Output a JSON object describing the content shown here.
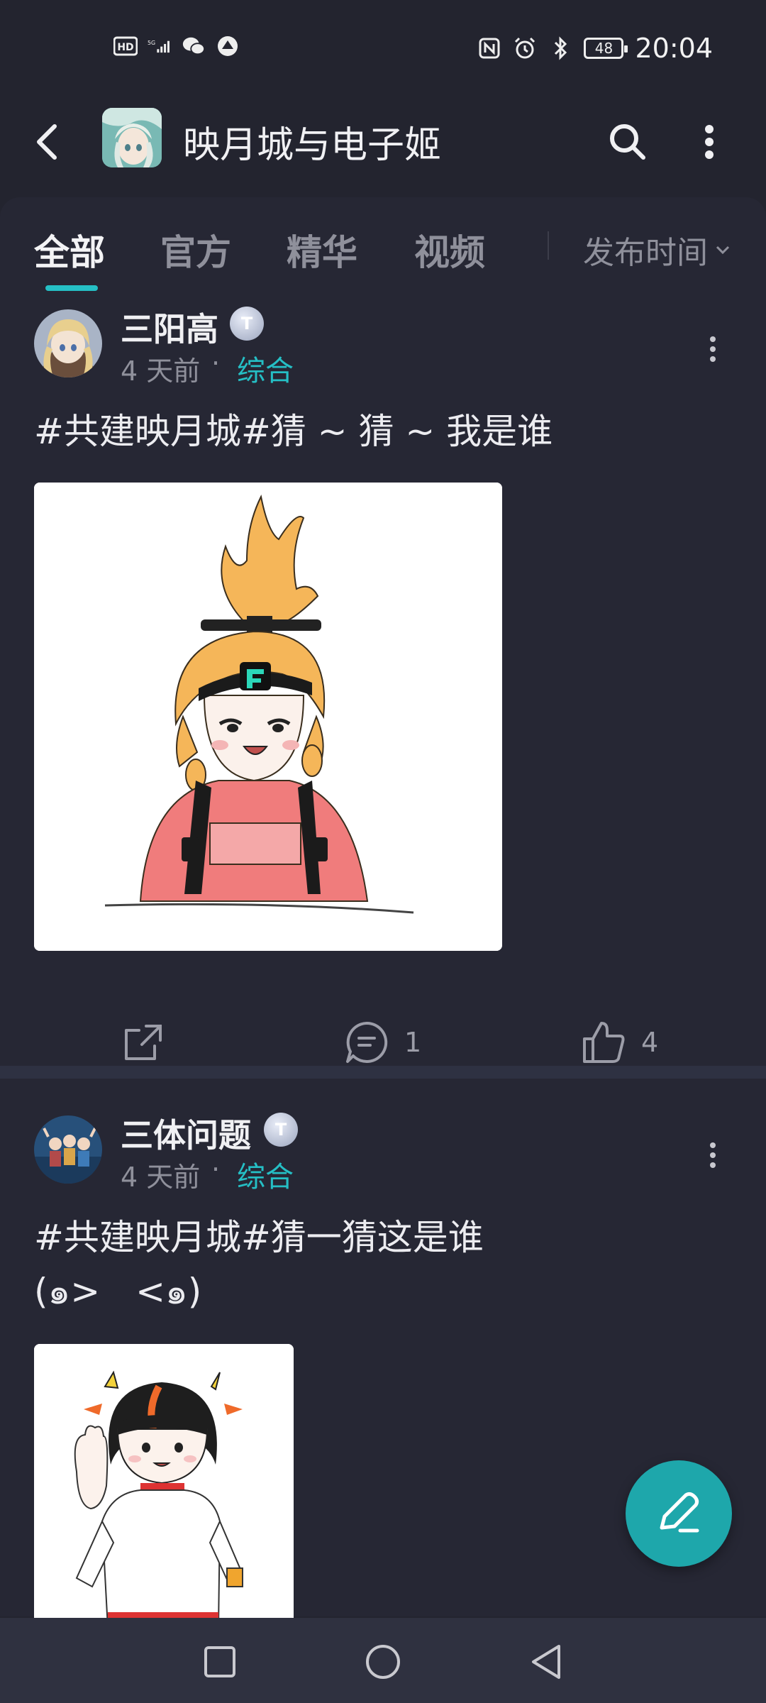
{
  "status_bar": {
    "time": "20:04",
    "battery": "48",
    "left_icons": [
      "hd-icon",
      "signal-5g-icon",
      "wechat-icon",
      "app-notification-icon"
    ],
    "right_icons": [
      "nfc-icon",
      "alarm-icon",
      "bluetooth-icon",
      "battery-icon"
    ]
  },
  "header": {
    "title": "映月城与电子姬",
    "back_icon": "back-arrow-icon",
    "search_icon": "search-icon",
    "more_icon": "more-vertical-icon"
  },
  "tabs": {
    "items": [
      "全部",
      "官方",
      "精华",
      "视频"
    ],
    "active_index": 0,
    "sort_label": "发布时间"
  },
  "posts": [
    {
      "author": "三阳高",
      "level_badge": "T",
      "time": "4 天前",
      "separator": "·",
      "category": "综合",
      "text": "#共建映月城#猜 ~ 猜 ~ 我是谁",
      "image_alt": "",
      "comments": "1",
      "likes": "4"
    },
    {
      "author": "三体问题",
      "level_badge": "T",
      "time": "4 天前",
      "separator": "·",
      "category": "综合",
      "text_line1": "#共建映月城#猜一猜这是谁",
      "text_line2": "(๑>　<๑)",
      "image_alt": ""
    }
  ],
  "fab": {
    "icon": "pen-icon"
  },
  "nav": {
    "icons": [
      "recents-square-icon",
      "home-circle-icon",
      "back-triangle-icon"
    ]
  },
  "colors": {
    "accent": "#25bfc5",
    "background": "#23242f",
    "card": "#262734"
  }
}
